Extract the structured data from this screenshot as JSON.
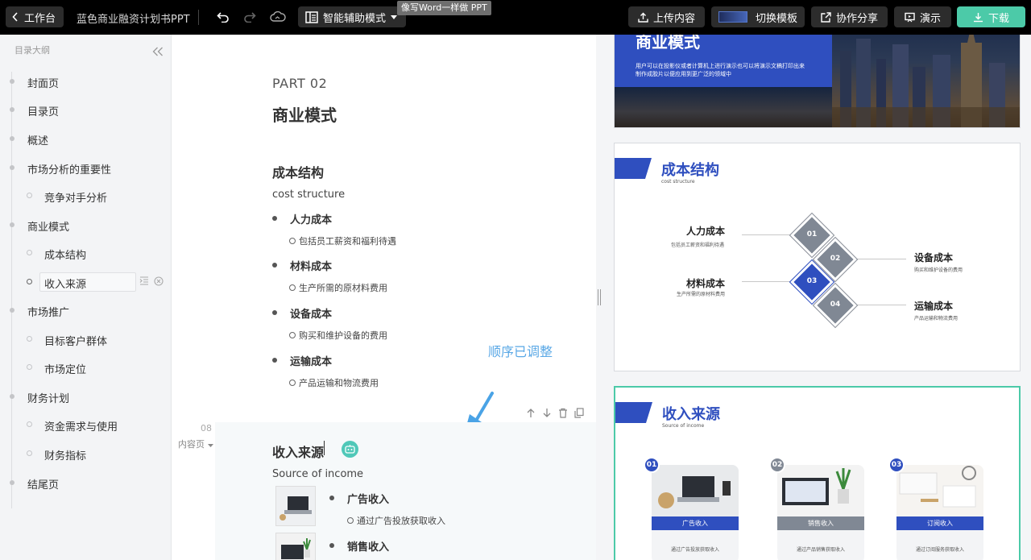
{
  "topbar": {
    "back_label": "工作台",
    "doc_title": "蓝色商业融资计划书PPT",
    "mode_label": "智能辅助模式",
    "mode_tooltip": "像写Word一样做 PPT",
    "upload_label": "上传内容",
    "switch_template_label": "切换模板",
    "share_label": "协作分享",
    "present_label": "演示",
    "download_label": "下载"
  },
  "sidebar": {
    "header": "目录大纲",
    "items": [
      {
        "label": "封面页",
        "level": 1
      },
      {
        "label": "目录页",
        "level": 1
      },
      {
        "label": "概述",
        "level": 1
      },
      {
        "label": "市场分析的重要性",
        "level": 1
      },
      {
        "label": "竞争对手分析",
        "level": 2
      },
      {
        "label": "商业模式",
        "level": 1
      },
      {
        "label": "成本结构",
        "level": 2
      },
      {
        "label": "收入来源",
        "level": 2,
        "active": true
      },
      {
        "label": "市场推广",
        "level": 1
      },
      {
        "label": "目标客户群体",
        "level": 2
      },
      {
        "label": "市场定位",
        "level": 2
      },
      {
        "label": "财务计划",
        "level": 1
      },
      {
        "label": "资金需求与使用",
        "level": 2
      },
      {
        "label": "财务指标",
        "level": 2
      },
      {
        "label": "结尾页",
        "level": 1
      }
    ]
  },
  "editor": {
    "part_label": "PART 02",
    "section_title": "商业模式",
    "cost": {
      "heading": "成本结构",
      "subtitle": "cost structure",
      "items": [
        {
          "title": "人力成本",
          "detail": "包括员工薪资和福利待遇"
        },
        {
          "title": "材料成本",
          "detail": "生产所需的原材料费用"
        },
        {
          "title": "设备成本",
          "detail": "购买和维护设备的费用"
        },
        {
          "title": "运输成本",
          "detail": "产品运输和物流费用"
        }
      ]
    },
    "annotation": "顺序已调整",
    "slide_number": "08",
    "slide_type": "内容页",
    "income": {
      "heading": "收入来源",
      "subtitle": "Source of income",
      "items": [
        {
          "title": "广告收入",
          "detail": "通过广告投放获取收入"
        },
        {
          "title": "销售收入",
          "detail": ""
        }
      ]
    }
  },
  "preview": {
    "slide1": {
      "title": "商业模式",
      "text": "用户可以在投影仪或者计算机上进行演示也可以将演示文稿打印出来制作成胶片以便应用到更广泛的领域中"
    },
    "slide2": {
      "title": "成本结构",
      "subtitle": "cost structure",
      "items": [
        {
          "num": "01",
          "title": "人力成本",
          "desc": "包括员工薪资和福利待遇"
        },
        {
          "num": "02",
          "title": "设备成本",
          "desc": "购买和维护设备的费用"
        },
        {
          "num": "03",
          "title": "材料成本",
          "desc": "生产所需的原材料费用"
        },
        {
          "num": "04",
          "title": "运输成本",
          "desc": "产品运输和物流费用"
        }
      ]
    },
    "slide3": {
      "title": "收入来源",
      "subtitle": "Source of income",
      "cards": [
        {
          "num": "01",
          "label": "广告收入",
          "desc": "通过广告投放获取收入"
        },
        {
          "num": "02",
          "label": "销售收入",
          "desc": "通过产品销售获取收入"
        },
        {
          "num": "03",
          "label": "订阅收入",
          "desc": "通过订阅服务获取收入"
        }
      ]
    }
  },
  "colors": {
    "accent_blue": "#2f4fbf",
    "accent_green": "#4ccaa8",
    "gray_diamond": "#808894"
  }
}
